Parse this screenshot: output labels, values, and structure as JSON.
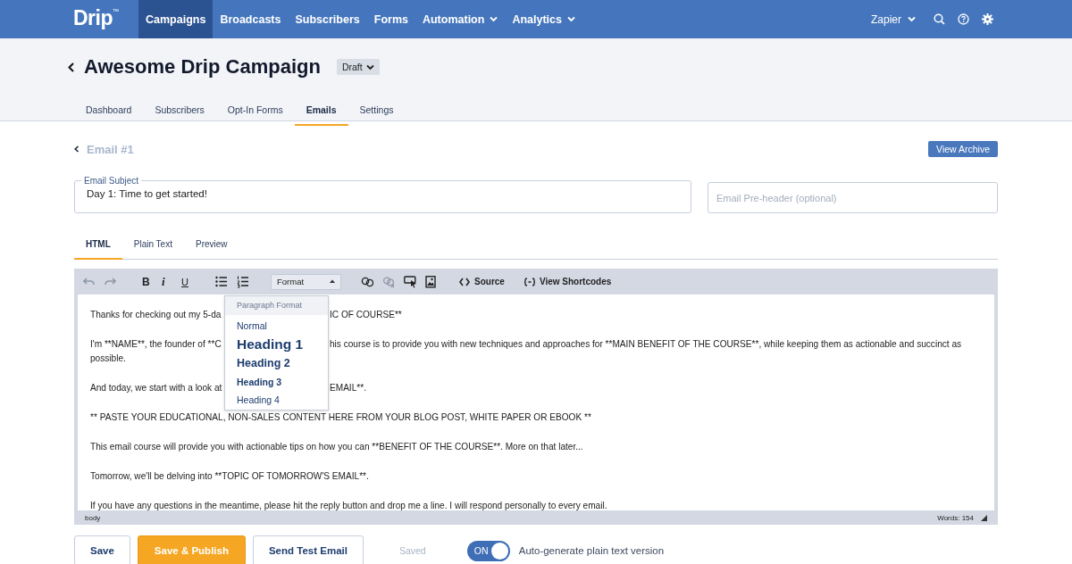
{
  "nav": {
    "logo": "Drip",
    "logo_mark": "™",
    "items": [
      {
        "label": "Campaigns",
        "selected": true,
        "has_menu": false
      },
      {
        "label": "Broadcasts",
        "selected": false,
        "has_menu": false
      },
      {
        "label": "Subscribers",
        "selected": false,
        "has_menu": false
      },
      {
        "label": "Forms",
        "selected": false,
        "has_menu": false
      },
      {
        "label": "Automation",
        "selected": false,
        "has_menu": true
      },
      {
        "label": "Analytics",
        "selected": false,
        "has_menu": true
      }
    ],
    "account": "Zapier"
  },
  "campaign": {
    "title": "Awesome Drip Campaign",
    "status": "Draft",
    "tabs": [
      {
        "label": "Dashboard",
        "selected": false
      },
      {
        "label": "Subscribers",
        "selected": false
      },
      {
        "label": "Opt-In Forms",
        "selected": false
      },
      {
        "label": "Emails",
        "selected": true
      },
      {
        "label": "Settings",
        "selected": false
      }
    ]
  },
  "email": {
    "title": "Email #1",
    "archive_button": "View Archive",
    "subject": {
      "label": "Email Subject",
      "value": "Day 1: Time to get started!"
    },
    "preheader": {
      "placeholder": "Email Pre-header (optional)"
    },
    "tabs": [
      {
        "label": "HTML",
        "selected": true
      },
      {
        "label": "Plain Text",
        "selected": false
      },
      {
        "label": "Preview",
        "selected": false
      }
    ]
  },
  "toolbar": {
    "tools": [
      {
        "kind": "undo",
        "disabled": true
      },
      {
        "kind": "redo",
        "disabled": true
      },
      {
        "kind": "bold",
        "text": "B",
        "disabled": false
      },
      {
        "kind": "italic",
        "text": "i",
        "disabled": false
      },
      {
        "kind": "underline",
        "text": "U",
        "disabled": false
      },
      {
        "kind": "bullets",
        "disabled": false
      },
      {
        "kind": "numbers",
        "disabled": false
      },
      {
        "kind": "select",
        "text": "Format",
        "expanded": true
      },
      {
        "kind": "link",
        "disabled": false
      },
      {
        "kind": "unlink",
        "disabled": true
      },
      {
        "kind": "cursor",
        "disabled": false
      },
      {
        "kind": "image",
        "disabled": false
      },
      {
        "kind": "source",
        "text": "Source",
        "disabled": false
      },
      {
        "kind": "shortcodes",
        "text": "View Shortcodes",
        "disabled": false
      }
    ],
    "menu": {
      "title": "Paragraph Format",
      "items": [
        {
          "kind": "normal",
          "label": "Normal"
        },
        {
          "kind": "h1",
          "label": "Heading 1"
        },
        {
          "kind": "h2",
          "label": "Heading 2"
        },
        {
          "kind": "h3",
          "label": "Heading 3"
        },
        {
          "kind": "h4",
          "label": "Heading 4"
        }
      ]
    }
  },
  "editor": {
    "paragraphs": [
      {
        "lines": [
          {
            "kind": "covered",
            "left": "Thanks for checking out my 5-da",
            "right": "IC OF COURSE**"
          }
        ]
      },
      {
        "lines": [
          {
            "kind": "covered",
            "left": "I'm **NAME**, the founder of **C",
            "right": "his course is to provide you with new techniques and approaches for **MAIN BENEFIT OF THE COURSE**, while keeping them as actionable and succinct as"
          },
          {
            "kind": "full",
            "text": "possible."
          }
        ]
      },
      {
        "lines": [
          {
            "kind": "covered",
            "left": "And today, we start with a look at",
            "right": "EMAIL**."
          }
        ]
      },
      {
        "lines": [
          {
            "kind": "full",
            "text": "** PASTE YOUR EDUCATIONAL, NON-SALES CONTENT HERE FROM YOUR BLOG POST, WHITE PAPER OR EBOOK **"
          }
        ]
      },
      {
        "lines": [
          {
            "kind": "full",
            "text": "This email course will provide you with actionable tips on how you can **BENEFIT OF THE COURSE**. More on that later..."
          }
        ]
      },
      {
        "lines": [
          {
            "kind": "full",
            "text": "Tomorrow, we'll be delving into **TOPIC OF TOMORROW'S EMAIL**."
          }
        ]
      },
      {
        "lines": [
          {
            "kind": "full",
            "text": "If you have any questions in the meantime, please hit the reply button and drop me a line. I will respond personally to every email."
          }
        ]
      }
    ],
    "path": "body",
    "word_count": "Words: 154"
  },
  "actions": {
    "buttons": [
      {
        "kind": "plain",
        "label": "Save"
      },
      {
        "kind": "primary",
        "label": "Save & Publish"
      },
      {
        "kind": "plain",
        "label": "Send Test Email"
      }
    ],
    "status": "Saved",
    "toggle": {
      "on": true,
      "text": "ON",
      "label": "Auto-generate plain text version"
    }
  }
}
